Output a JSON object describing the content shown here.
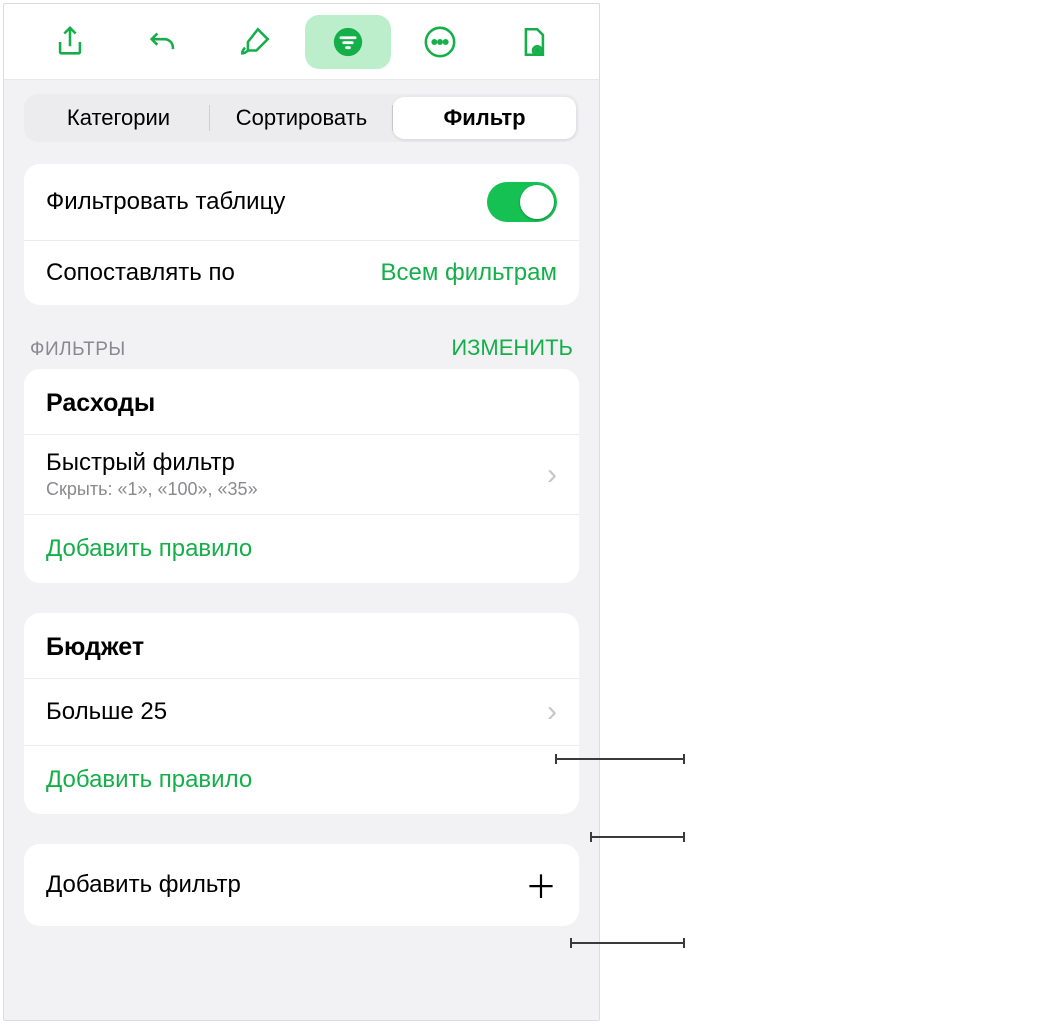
{
  "toolbar": {
    "icons": [
      "share-icon",
      "undo-icon",
      "brush-icon",
      "filter-icon",
      "more-icon",
      "document-view-icon"
    ]
  },
  "segmented": {
    "categories": "Категории",
    "sort": "Сортировать",
    "filter": "Фильтр"
  },
  "filterSettings": {
    "filterTableLabel": "Фильтровать таблицу",
    "matchByLabel": "Сопоставлять по",
    "matchByValue": "Всем фильтрам"
  },
  "sectionHeader": {
    "caption": "ФИЛЬТРЫ",
    "edit": "ИЗМЕНИТЬ"
  },
  "groups": [
    {
      "title": "Расходы",
      "rules": [
        {
          "title": "Быстрый фильтр",
          "subtitle": "Скрыть: «1», «100», «35»"
        }
      ],
      "addRule": "Добавить правило"
    },
    {
      "title": "Бюджет",
      "rules": [
        {
          "title": "Больше 25",
          "subtitle": ""
        }
      ],
      "addRule": "Добавить правило"
    }
  ],
  "addFilter": "Добавить фильтр",
  "colors": {
    "accent": "#15af4a"
  }
}
